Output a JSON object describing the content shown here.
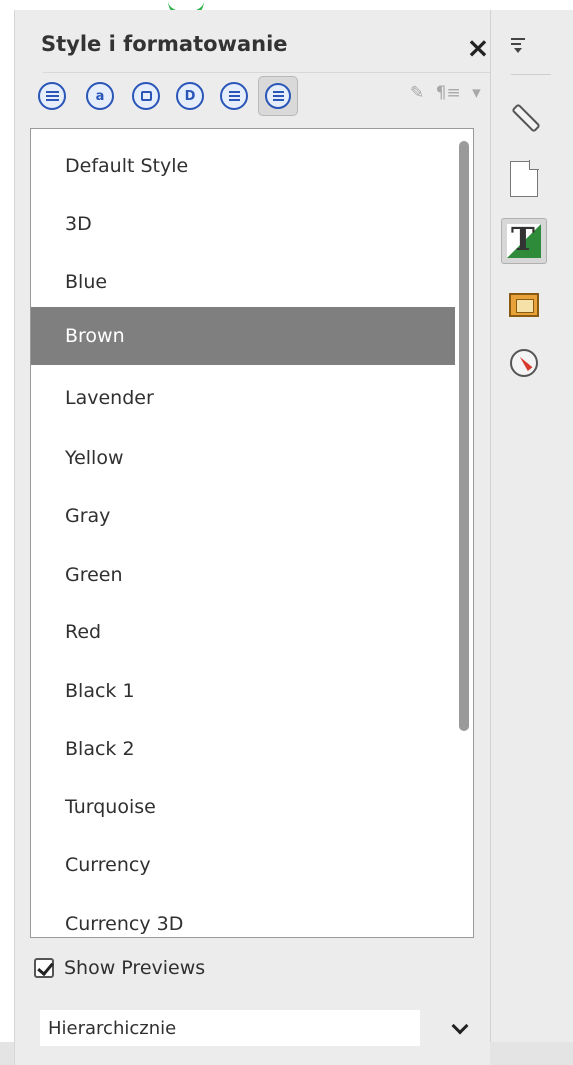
{
  "panel": {
    "title": "Style i formatowanie",
    "close_label": "×"
  },
  "toolbar": {
    "families": [
      {
        "icon": "paragraph-styles-icon"
      },
      {
        "icon": "character-styles-icon"
      },
      {
        "icon": "frame-styles-icon"
      },
      {
        "icon": "page-styles-icon"
      },
      {
        "icon": "list-styles-icon"
      },
      {
        "icon": "table-styles-icon",
        "active": true
      }
    ],
    "fill_format_label": "fill-format-mode-icon",
    "new_style_label": "¶≡",
    "new_style_dropdown": "▾"
  },
  "styles": [
    {
      "label": "Default Style"
    },
    {
      "label": "3D"
    },
    {
      "label": "Blue"
    },
    {
      "label": "Brown",
      "selected": true
    },
    {
      "label": "Lavender"
    },
    {
      "label": "Yellow"
    },
    {
      "label": "Gray"
    },
    {
      "label": "Green"
    },
    {
      "label": "Red"
    },
    {
      "label": "Black 1"
    },
    {
      "label": "Black 2"
    },
    {
      "label": "Turquoise"
    },
    {
      "label": "Currency"
    },
    {
      "label": "Currency 3D"
    }
  ],
  "show_previews": {
    "label": "Show Previews",
    "checked": true
  },
  "filter": {
    "value": "Hierarchicznie"
  },
  "sidebar_tabs": [
    {
      "icon": "menu-icon"
    },
    {
      "icon": "properties-wrench-icon"
    },
    {
      "icon": "page-icon"
    },
    {
      "icon": "styles-icon",
      "active": true
    },
    {
      "icon": "gallery-icon"
    },
    {
      "icon": "navigator-icon"
    }
  ],
  "colors": {
    "accent": "#2a56b8",
    "selection": "#7f7f7f",
    "panel_bg": "#ececec"
  }
}
